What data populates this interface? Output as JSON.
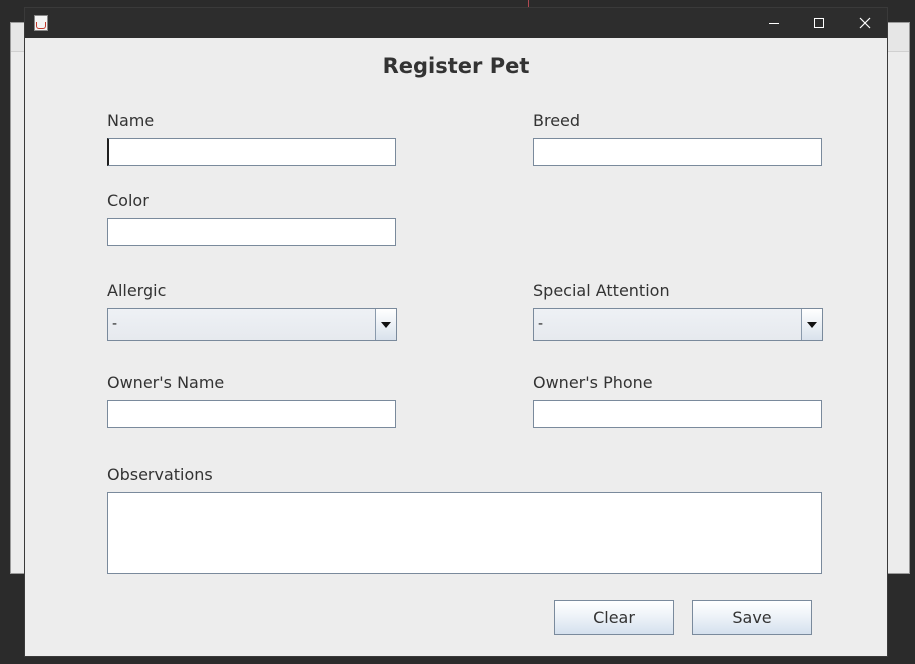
{
  "window": {
    "title": "",
    "icon": "java-cup-icon"
  },
  "form": {
    "title": "Register Pet",
    "fields": {
      "name": {
        "label": "Name",
        "value": ""
      },
      "breed": {
        "label": "Breed",
        "value": ""
      },
      "color": {
        "label": "Color",
        "value": ""
      },
      "allergic": {
        "label": "Allergic",
        "selected": "-"
      },
      "special_attention": {
        "label": "Special Attention",
        "selected": "-"
      },
      "owner_name": {
        "label": "Owner's Name",
        "value": ""
      },
      "owner_phone": {
        "label": "Owner's Phone",
        "value": ""
      },
      "observations": {
        "label": "Observations",
        "value": ""
      }
    },
    "buttons": {
      "clear": "Clear",
      "save": "Save"
    }
  },
  "colors": {
    "titlebar": "#2d2d2d",
    "dialog_background": "#ededed",
    "text": "#333333",
    "field_border": "#7a8a9c"
  }
}
